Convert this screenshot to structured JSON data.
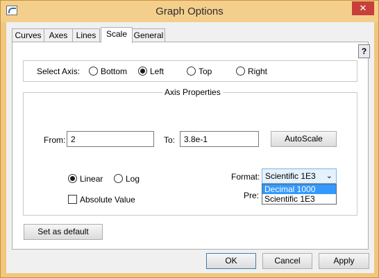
{
  "window": {
    "title": "Graph Options",
    "close_symbol": "✕"
  },
  "tabs": [
    {
      "label": "Curves",
      "active": false
    },
    {
      "label": "Axes",
      "active": false
    },
    {
      "label": "Lines",
      "active": false
    },
    {
      "label": "Scale",
      "active": true
    },
    {
      "label": "General",
      "active": false
    }
  ],
  "help_label": "?",
  "select_axis": {
    "label": "Select Axis:",
    "options": [
      "Bottom",
      "Left",
      "Top",
      "Right"
    ],
    "selected": "Left"
  },
  "axis_properties": {
    "title": "Axis Properties",
    "from_label": "From:",
    "from_value": "2",
    "to_label": "To:",
    "to_value": "3.8e-1",
    "autoscale_label": "AutoScale",
    "scale_options": [
      "Linear",
      "Log"
    ],
    "scale_selected": "Linear",
    "absolute_value_label": "Absolute Value",
    "absolute_value_checked": false,
    "format_label": "Format:",
    "format_value": "Scientific 1E3",
    "format_options": [
      "Decimal 1000",
      "Scientific 1E3"
    ],
    "format_highlighted": "Decimal 1000",
    "precision_label": "Pre:"
  },
  "set_default_label": "Set as default",
  "footer": {
    "ok_label": "OK",
    "cancel_label": "Cancel",
    "apply_label": "Apply"
  }
}
